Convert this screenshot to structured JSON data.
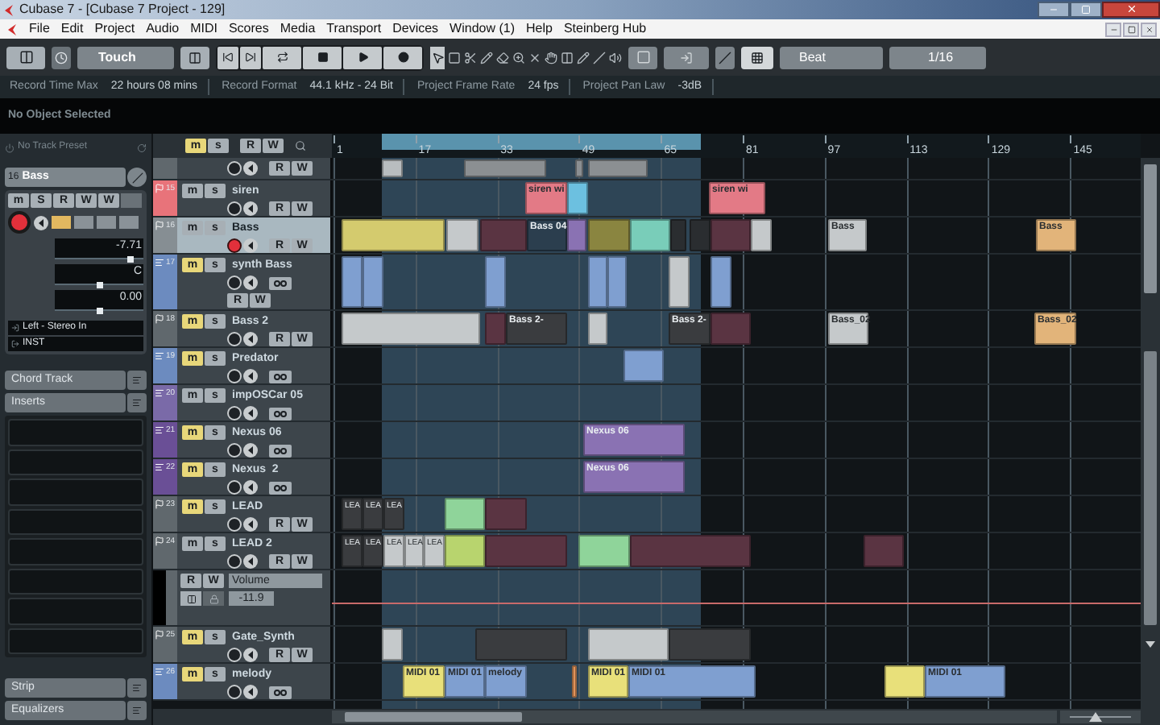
{
  "window": {
    "title": "Cubase 7 - [Cubase 7 Project - 129]"
  },
  "menu": [
    "File",
    "Edit",
    "Project",
    "Audio",
    "MIDI",
    "Scores",
    "Media",
    "Transport",
    "Devices",
    "Window (1)",
    "Help",
    "Steinberg Hub"
  ],
  "toolbar": {
    "automation_mode": "Touch",
    "snap_type": "Beat",
    "quantize": "1/16"
  },
  "info_line": [
    {
      "label": "Record Time Max",
      "value": "22 hours 08 mins"
    },
    {
      "label": "Record Format",
      "value": "44.1 kHz - 24 Bit"
    },
    {
      "label": "Project Frame Rate",
      "value": "24 fps"
    },
    {
      "label": "Project Pan Law",
      "value": "-3dB"
    }
  ],
  "info_bar": {
    "text": "No Object Selected"
  },
  "inspector": {
    "preset": "No Track Preset",
    "track_number": "16",
    "track_name": "Bass",
    "buttons": [
      "m",
      "S",
      "R",
      "W",
      "W"
    ],
    "record": true,
    "volume": {
      "value": "-7.71",
      "level": 0.86
    },
    "pan": {
      "value": "C",
      "level": 0.5
    },
    "delay": {
      "value": "0.00",
      "level": 0.5
    },
    "input": "Left - Stereo In",
    "output": "INST",
    "sections": [
      "Chord Track",
      "Inserts"
    ],
    "bottom_sections": [
      "Strip",
      "Equalizers"
    ]
  },
  "tracklist_header": {
    "buttons": [
      {
        "label": "m",
        "on": true
      },
      {
        "label": "s",
        "on": false
      },
      {
        "label": "R",
        "on": false
      },
      {
        "label": "W",
        "on": false
      }
    ]
  },
  "ruler": {
    "ticks": [
      "1",
      "17",
      "33",
      "49",
      "65",
      "81",
      "97",
      "113",
      "129",
      "145"
    ]
  },
  "tracks": [
    {
      "kind": "audio",
      "color": "#60686d",
      "record": false,
      "buttons": [
        "R",
        "W"
      ],
      "clips": [
        {
          "color": "#b9bdbf"
        },
        {
          "color": "#8b8f92"
        },
        {
          "color": "#8b8f92"
        },
        {
          "color": "#8b8f92"
        }
      ]
    },
    {
      "number": "15",
      "name": "siren",
      "kind": "audio",
      "color": "#e8737a",
      "mute": "m",
      "solo": "s",
      "muted": false,
      "selected": false,
      "record": false,
      "buttons": [
        "R",
        "W"
      ],
      "clips": [
        {
          "label": "siren wi",
          "color": "#e37a86"
        },
        {
          "color": "#6cc0e0"
        },
        {
          "label": "siren wi",
          "color": "#e37a86"
        }
      ]
    },
    {
      "number": "16",
      "name": "Bass",
      "kind": "audio",
      "color": "#868e93",
      "mute": "m",
      "solo": "s",
      "muted": false,
      "selected": true,
      "record": true,
      "buttons": [
        "R",
        "W"
      ],
      "clips": [
        {
          "color": "#d4cb6e"
        },
        {
          "color": "#c5c9cb"
        },
        {
          "color": "#5a3442"
        },
        {
          "label": "Bass 04",
          "color": "#2b3e4e"
        },
        {
          "color": "#8a72b3"
        },
        {
          "color": "#8a8540"
        },
        {
          "color": "#79cdb9"
        },
        {
          "color": "#2a2d30"
        },
        {
          "color": "#2a2d30"
        },
        {
          "color": "#5a3442"
        },
        {
          "color": "#c5c9cb"
        },
        {
          "label": "Bass",
          "color": "#c5c9cb"
        },
        {
          "label": "Bass",
          "color": "#e2b47a"
        }
      ]
    },
    {
      "number": "17",
      "name": "synth Bass",
      "kind": "instrument",
      "color": "#6c8bbf",
      "mute": "m",
      "solo": "s",
      "muted": true,
      "selected": false,
      "record": false,
      "buttons": [
        "R",
        "W"
      ],
      "clips": [
        {
          "color": "#7f9fd0"
        },
        {
          "color": "#7f9fd0"
        },
        {
          "color": "#7f9fd0"
        },
        {
          "color": "#7f9fd0"
        },
        {
          "color": "#7f9fd0"
        },
        {
          "color": "#c5c9cb"
        },
        {
          "color": "#7f9fd0"
        }
      ]
    },
    {
      "number": "18",
      "name": "Bass 2",
      "kind": "audio",
      "color": "#60686d",
      "mute": "m",
      "solo": "s",
      "muted": true,
      "selected": false,
      "record": false,
      "buttons": [
        "R",
        "W"
      ],
      "clips": [
        {
          "color": "#c5c9cb"
        },
        {
          "color": "#5a3442"
        },
        {
          "label": "Bass 2-",
          "color": "#3a3c3f"
        },
        {
          "color": "#c5c9cb"
        },
        {
          "label": "Bass 2-",
          "color": "#3a3c3f"
        },
        {
          "color": "#5a3442"
        },
        {
          "label": "Bass_02",
          "color": "#c5c9cb"
        },
        {
          "label": "Bass_02",
          "color": "#e2b47a"
        }
      ]
    },
    {
      "number": "19",
      "name": "Predator",
      "kind": "instrument",
      "color": "#6c8bbf",
      "mute": "m",
      "solo": "s",
      "muted": true,
      "selected": false,
      "record": false,
      "clips": [
        {
          "color": "#7f9fd0"
        }
      ]
    },
    {
      "number": "20",
      "name": "impOSCar 05",
      "kind": "instrument",
      "color": "#7a6aa8",
      "mute": "m",
      "solo": "s",
      "muted": false,
      "selected": false,
      "record": false
    },
    {
      "number": "21",
      "name": "Nexus 06",
      "kind": "instrument",
      "color": "#6a4f96",
      "mute": "m",
      "solo": "s",
      "muted": true,
      "selected": false,
      "record": false,
      "clips": [
        {
          "label": "Nexus 06",
          "color": "#8a72b3"
        }
      ]
    },
    {
      "number": "22",
      "name": "Nexus  2",
      "kind": "instrument",
      "color": "#6a4f96",
      "mute": "m",
      "solo": "s",
      "muted": true,
      "selected": false,
      "record": false,
      "clips": [
        {
          "label": "Nexus 06",
          "color": "#8a72b3"
        }
      ]
    },
    {
      "number": "23",
      "name": "LEAD",
      "kind": "audio",
      "color": "#60686d",
      "mute": "m",
      "solo": "s",
      "muted": true,
      "selected": false,
      "record": false,
      "buttons": [
        "R",
        "W"
      ],
      "clips": [
        {
          "label": "LEA",
          "color": "#3a3c3f"
        },
        {
          "label": "LEA",
          "color": "#3a3c3f"
        },
        {
          "label": "LEA",
          "color": "#3a3c3f"
        },
        {
          "color": "#8fd49a"
        },
        {
          "color": "#5a3442"
        }
      ]
    },
    {
      "number": "24",
      "name": "LEAD 2",
      "kind": "audio",
      "color": "#60686d",
      "mute": "m",
      "solo": "s",
      "muted": false,
      "selected": false,
      "record": false,
      "buttons": [
        "R",
        "W"
      ],
      "clips": [
        {
          "label": "LEA",
          "color": "#3a3c3f"
        },
        {
          "label": "LEA",
          "color": "#3a3c3f"
        },
        {
          "label": "LEA",
          "color": "#c5c9cb"
        },
        {
          "label": "LEA",
          "color": "#c5c9cb"
        },
        {
          "label": "LEA",
          "color": "#c5c9cb"
        },
        {
          "color": "#b8d46e"
        },
        {
          "color": "#5a3442"
        },
        {
          "color": "#8fd49a"
        },
        {
          "color": "#5a3442"
        },
        {
          "color": "#5a3442"
        }
      ]
    },
    {
      "kind": "automation",
      "buttons": [
        "R",
        "W"
      ],
      "parameter": "Volume",
      "value": "-11.9"
    },
    {
      "number": "25",
      "name": "Gate_Synth",
      "kind": "audio",
      "color": "#60686d",
      "mute": "m",
      "solo": "s",
      "muted": true,
      "selected": false,
      "record": false,
      "buttons": [
        "R",
        "W"
      ],
      "clips": [
        {
          "color": "#c5c9cb"
        },
        {
          "color": "#3a3c3f"
        },
        {
          "color": "#c5c9cb"
        },
        {
          "color": "#3a3c3f"
        }
      ]
    },
    {
      "number": "26",
      "name": "melody",
      "kind": "instrument",
      "color": "#6c8bbf",
      "mute": "m",
      "solo": "s",
      "muted": true,
      "selected": false,
      "record": false,
      "clips": [
        {
          "label": "MIDI 01",
          "color": "#e8e07a"
        },
        {
          "label": "MIDI 01",
          "color": "#7f9fd0"
        },
        {
          "label": "melody",
          "color": "#7f9fd0"
        },
        {
          "color": "#e2945a"
        },
        {
          "label": "MIDI 01",
          "color": "#e8e07a"
        },
        {
          "label": "MIDI 01",
          "color": "#7f9fd0"
        },
        {
          "color": "#e8e07a"
        },
        {
          "label": "MIDI 01",
          "color": "#7f9fd0"
        }
      ]
    }
  ]
}
